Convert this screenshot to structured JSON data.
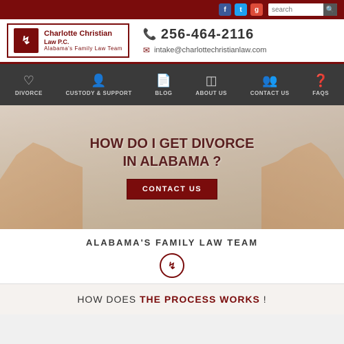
{
  "topbar": {
    "social": [
      "f",
      "t",
      "g+"
    ],
    "search_placeholder": "search"
  },
  "header": {
    "logo": {
      "icon_text": "CH",
      "firm_name": "Charlotte Christian",
      "law_pc": "Law P.C.",
      "tagline": "Alabama's Family Law Team"
    },
    "phone": "256-464-2116",
    "email": "intake@charlottechristianlaw.com"
  },
  "nav": {
    "items": [
      {
        "icon": "♡",
        "label": "DIVORCE"
      },
      {
        "icon": "👤",
        "label": "CUSTODY & SUPPORT"
      },
      {
        "icon": "📋",
        "label": "BLOG"
      },
      {
        "icon": "⊞",
        "label": "ABOUT US"
      },
      {
        "icon": "👥",
        "label": "CONTACT US"
      },
      {
        "icon": "?",
        "label": "FAQS"
      }
    ]
  },
  "hero": {
    "title_line1": "HOW DO I GET DIVORCE",
    "title_line2": "IN ALABAMA ?",
    "cta_label": "CONTACT US"
  },
  "family_law": {
    "title": "ALABAMA'S FAMILY LAW  TEAM",
    "icon_text": "CH"
  },
  "process": {
    "prefix": "HOW DOES",
    "highlight": "THE PROCESS WORKS",
    "suffix": " !"
  }
}
